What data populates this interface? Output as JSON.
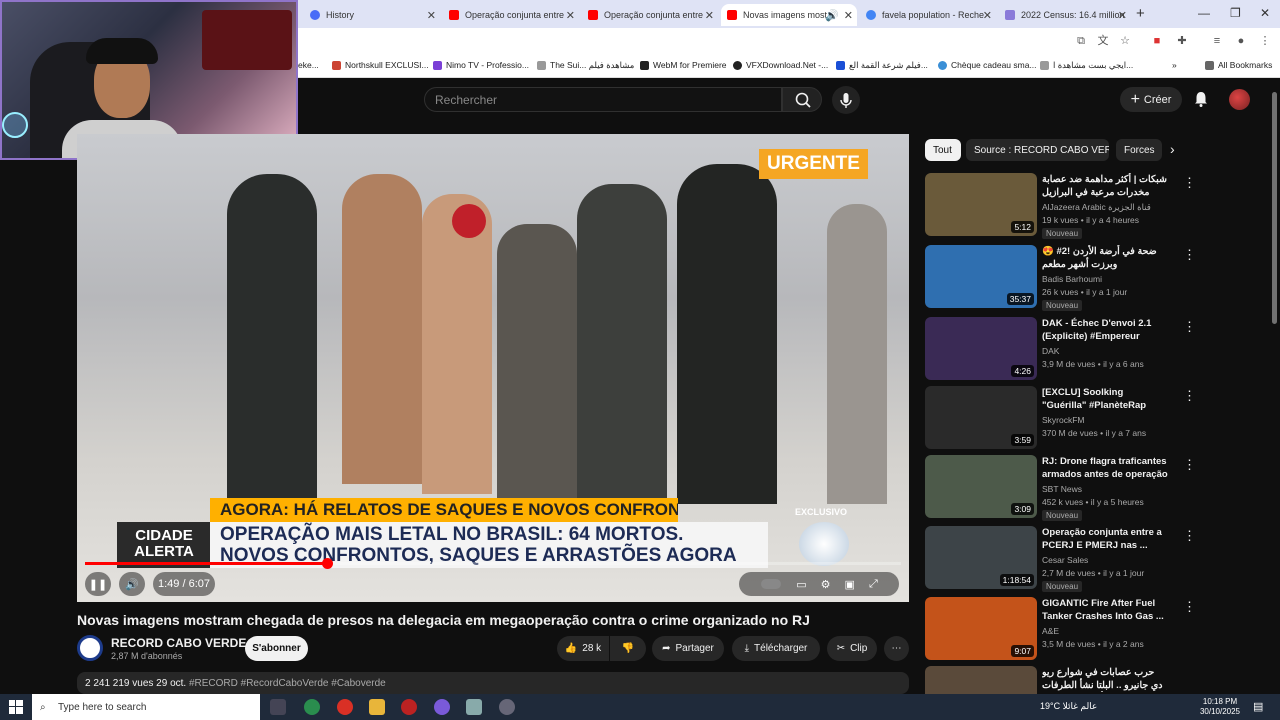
{
  "browser": {
    "tabs": [
      {
        "label": "History",
        "favicon_color": "#4a6cf7"
      },
      {
        "label": "Operação conjunta entre",
        "favicon_color": "#ff0000"
      },
      {
        "label": "Operação conjunta entre",
        "favicon_color": "#ff0000"
      },
      {
        "label": "Novas imagens most",
        "favicon_color": "#ff0000",
        "active": true
      },
      {
        "label": "favela population - Reche",
        "favicon_color": "#4285f4"
      },
      {
        "label": "2022 Census: 16.4 million",
        "favicon_color": "#8a7ad9"
      }
    ],
    "bookmarks": [
      {
        "label": "eke..."
      },
      {
        "label": "Northskull EXCLUSI..."
      },
      {
        "label": "Nimo TV - Professio..."
      },
      {
        "label": "The Sui... مشاهدة فيلم"
      },
      {
        "label": "WebM for Premiere"
      },
      {
        "label": "VFXDownload.Net -..."
      },
      {
        "label": "فيلم شرعة القمة الع..."
      },
      {
        "label": "Chèque cadeau sma..."
      },
      {
        "label": "ايجي بست مشاهدة ا..."
      }
    ],
    "all_bookmarks": "All Bookmarks"
  },
  "header": {
    "search_placeholder": "Rechercher",
    "create_label": "Créer"
  },
  "player": {
    "overlay_urgente": "URGENTE",
    "lower_third_1": "AGORA: HÁ RELATOS DE SAQUES E NOVOS CONFRONTOS",
    "lower_third_2a": "OPERAÇÃO MAIS LETAL NO BRASIL: 64 MORTOS.",
    "lower_third_2b": "NOVOS CONFRONTOS, SAQUES E ARRASTÕES AGORA",
    "cidade_alerta": "CIDADE ALERTA",
    "exclusivo": "EXCLUSIVO",
    "time": "1:49 / 6:07",
    "progress_fraction": 0.297
  },
  "video": {
    "title": "Novas imagens mostram chegada de presos na delegacia em megaoperação contra o crime organizado no RJ",
    "channel": "RECORD CABO VERDE",
    "subscribers": "2,87 M d'abonnés",
    "subscribe_label": "S'abonner",
    "likes": "28 k",
    "share_label": "Partager",
    "download_label": "Télécharger",
    "clip_label": "Clip",
    "views_date": "2 241 219 vues  29 oct.",
    "tags": "#RECORD #RecordCaboVerde #Caboverde"
  },
  "chips": [
    {
      "label": "Tout",
      "active": true
    },
    {
      "label": "Source : RECORD CABO VERDE"
    },
    {
      "label": "Forces"
    }
  ],
  "recommendations": [
    {
      "title": "شبكات | أكثر مداهمة ضد عصابة مخدرات مرعبة في البرازيل والقتلى بالعشرات",
      "channel": "AlJazeera Arabic قناة الجزيرة",
      "meta": "19 k vues • il y a 4 heures",
      "duration": "5:12",
      "badge": "Nouveau",
      "thumb": "#6a5a3a"
    },
    {
      "title": "😍 #2! ضحة في أرضة الأردن وبرزت أشهر مطعم",
      "channel": "Badis Barhoumi",
      "meta": "26 k vues • il y a 1 jour",
      "duration": "35:37",
      "badge": "Nouveau",
      "thumb": "#2f6fb0"
    },
    {
      "title": "DAK - Échec D'envoi 2.1 (Explicite) #Empereur",
      "channel": "DAK",
      "meta": "3,9 M de vues • il y a 6 ans",
      "duration": "4:26",
      "badge": "",
      "thumb": "#3a2a55"
    },
    {
      "title": "[EXCLU] Soolking \"Guérilla\" #PlanèteRap",
      "channel": "SkyrockFM",
      "meta": "370 M de vues • il y a 7 ans",
      "duration": "3:59",
      "badge": "",
      "thumb": "#2a2a2a"
    },
    {
      "title": "RJ: Drone flagra traficantes armados antes de operação ...",
      "channel": "SBT News",
      "meta": "452 k vues • il y a 5 heures",
      "duration": "3:09",
      "badge": "Nouveau",
      "thumb": "#4d5a4a"
    },
    {
      "title": "Operação conjunta entre a PCERJ E PMERJ nas ...",
      "channel": "Cesar Sales",
      "meta": "2,7 M de vues • il y a 1 jour",
      "duration": "1:18:54",
      "badge": "Nouveau",
      "thumb": "#3d4448"
    },
    {
      "title": "GIGANTIC Fire After Fuel Tanker Crashes Into Gas ...",
      "channel": "A&E",
      "meta": "3,5 M de vues • il y a 2 ans",
      "duration": "9:07",
      "badge": "",
      "thumb": "#c4531a"
    },
    {
      "title": "حرب عصابات في شوارع ريو دي جانيرو .. البلتا نشأ الطرفات بعد أكبر مواجهة بين",
      "channel": "",
      "meta": "",
      "duration": "",
      "badge": "",
      "thumb": "#5a4a3a"
    }
  ],
  "taskbar": {
    "search_placeholder": "Type here to search",
    "weather": "19°C  عالم غائلا",
    "time": "10:18 PM",
    "date": "30/10/2025"
  }
}
